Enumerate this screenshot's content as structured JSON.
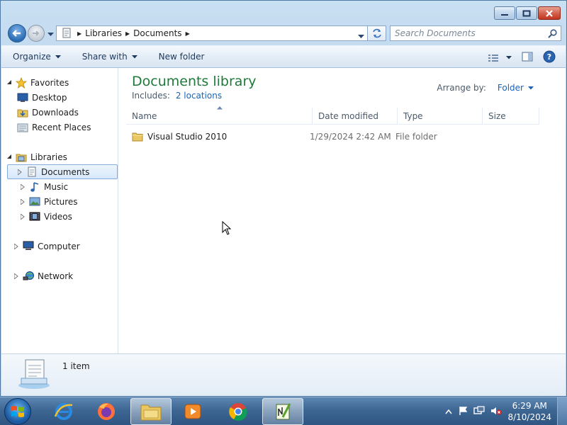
{
  "window": {
    "colors": {
      "accent": "#1e7a3a",
      "link": "#1a63b8"
    }
  },
  "address": {
    "crumbs": [
      "Libraries",
      "Documents"
    ],
    "search_placeholder": "Search Documents"
  },
  "toolbar": {
    "organize": "Organize",
    "share_with": "Share with",
    "new_folder": "New folder"
  },
  "nav": {
    "favorites": "Favorites",
    "desktop": "Desktop",
    "downloads": "Downloads",
    "recent_places": "Recent Places",
    "libraries": "Libraries",
    "documents": "Documents",
    "music": "Music",
    "pictures": "Pictures",
    "videos": "Videos",
    "computer": "Computer",
    "network": "Network"
  },
  "content": {
    "title": "Documents library",
    "includes_label": "Includes:",
    "includes_link": "2 locations",
    "arrange_label": "Arrange by:",
    "arrange_value": "Folder",
    "columns": {
      "name": "Name",
      "date_modified": "Date modified",
      "type": "Type",
      "size": "Size"
    },
    "files": [
      {
        "name": "Visual Studio 2010",
        "date_modified": "1/29/2024 2:42 AM",
        "type": "File folder",
        "size": ""
      }
    ]
  },
  "details": {
    "item_count": "1 item"
  },
  "taskbar": {
    "time": "6:29 AM",
    "date": "8/10/2024"
  }
}
